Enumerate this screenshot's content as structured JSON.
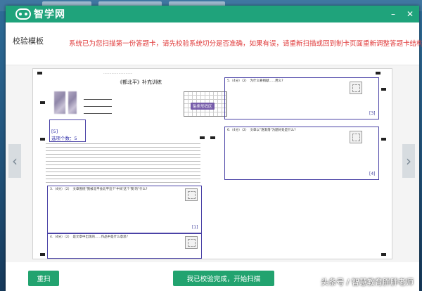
{
  "app": {
    "name": "智学网"
  },
  "header": {
    "title": "校验模板",
    "notice": "系统已为您扫描第一份答题卡，请先校验系统切分是否准确，如果有误，请重新扫描或回到制卡页面重新调整答题卡结构"
  },
  "sheet": {
    "title": "《都北平》补充训练",
    "selection_tag": "[5]",
    "selection_count": "选项个数：5",
    "stamp_text": "贴条形码区",
    "questions": [
      {
        "label": "5.（4分）（2）　为什么要捐献......用么?",
        "tag": "[3]"
      },
      {
        "label": "6.（4分）（2）　文章以\"逐渐落\"为题好处是什么?",
        "tag": "[4]"
      },
      {
        "label": "3.（4分）（2）　文章围绕\"我被北平会北平这个'中间'这个'我'的\"什么?",
        "tag": "[1]"
      },
      {
        "label": "4.（4分）（2）　是文章中出现的......作品中是什么意思?",
        "tag": ""
      }
    ]
  },
  "footer": {
    "rescan_label": "重扫",
    "start_label": "我已校验完成，开始扫描"
  },
  "watermark": "头条号 / 智慧教育胖胖老师"
}
